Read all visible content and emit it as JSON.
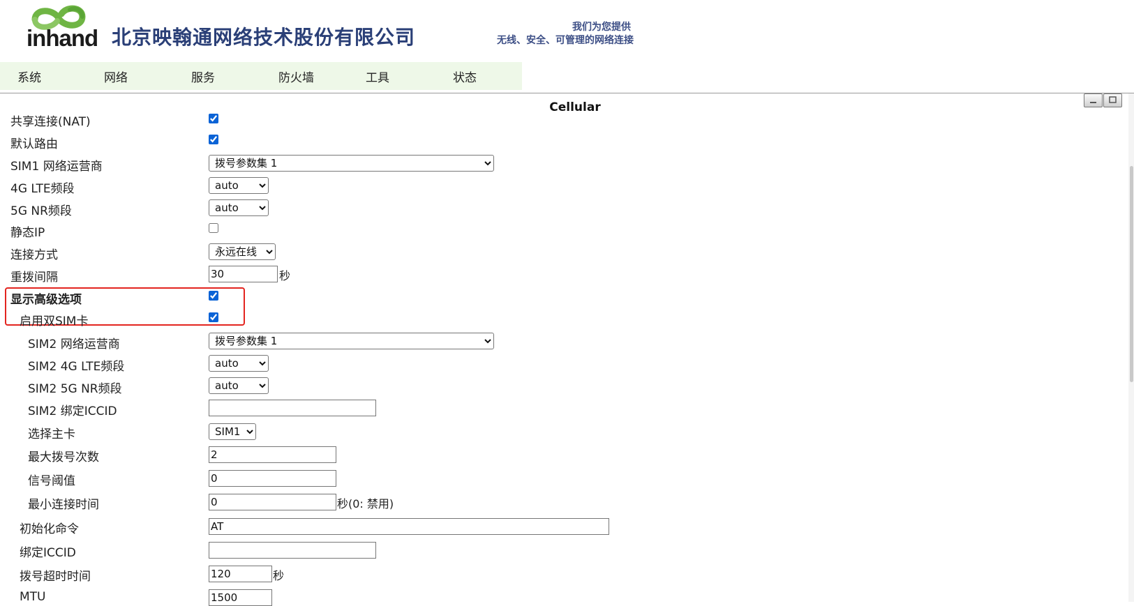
{
  "header": {
    "logo_text": "inhand",
    "company": "北京映翰通网络技术股份有限公司",
    "slogan_line1": "我们为您提供",
    "slogan_line2": "无线、安全、可管理的网络连接"
  },
  "nav": {
    "items": [
      "系统",
      "网络",
      "服务",
      "防火墙",
      "工具",
      "状态"
    ]
  },
  "page": {
    "title": "Cellular"
  },
  "form": {
    "nat_label": "共享连接(NAT)",
    "nat_checked": true,
    "default_route_label": "默认路由",
    "default_route_checked": true,
    "sim1_carrier_label": "SIM1 网络运营商",
    "sim1_carrier_value": "拨号参数集 1",
    "lte_band_label": "4G LTE频段",
    "lte_band_value": "auto",
    "nr_band_label": "5G NR频段",
    "nr_band_value": "auto",
    "static_ip_label": "静态IP",
    "static_ip_checked": false,
    "conn_mode_label": "连接方式",
    "conn_mode_value": "永远在线",
    "redial_interval_label": "重拨间隔",
    "redial_interval_value": "30",
    "redial_interval_unit": "秒",
    "advanced_label": "显示高级选项",
    "advanced_checked": true,
    "dual_sim_label": "启用双SIM卡",
    "dual_sim_checked": true,
    "sim2_carrier_label": "SIM2 网络运营商",
    "sim2_carrier_value": "拨号参数集 1",
    "sim2_lte_label": "SIM2 4G LTE频段",
    "sim2_lte_value": "auto",
    "sim2_nr_label": "SIM2 5G NR频段",
    "sim2_nr_value": "auto",
    "sim2_iccid_label": "SIM2 绑定ICCID",
    "sim2_iccid_value": "",
    "main_card_label": "选择主卡",
    "main_card_value": "SIM1",
    "max_dial_label": "最大拨号次数",
    "max_dial_value": "2",
    "signal_threshold_label": "信号阈值",
    "signal_threshold_value": "0",
    "min_conn_time_label": "最小连接时间",
    "min_conn_time_value": "0",
    "min_conn_time_unit": "秒(0: 禁用)",
    "init_cmd_label": "初始化命令",
    "init_cmd_value": "AT",
    "bind_iccid_label": "绑定ICCID",
    "bind_iccid_value": "",
    "dial_timeout_label": "拨号超时时间",
    "dial_timeout_value": "120",
    "dial_timeout_unit": "秒",
    "mtu_label": "MTU",
    "mtu_value": "1500"
  },
  "colors": {
    "nav_bg": "#eef8e8",
    "highlight": "#e3241f",
    "brand_green": "#6fb544",
    "company_text": "#2a3f77"
  }
}
